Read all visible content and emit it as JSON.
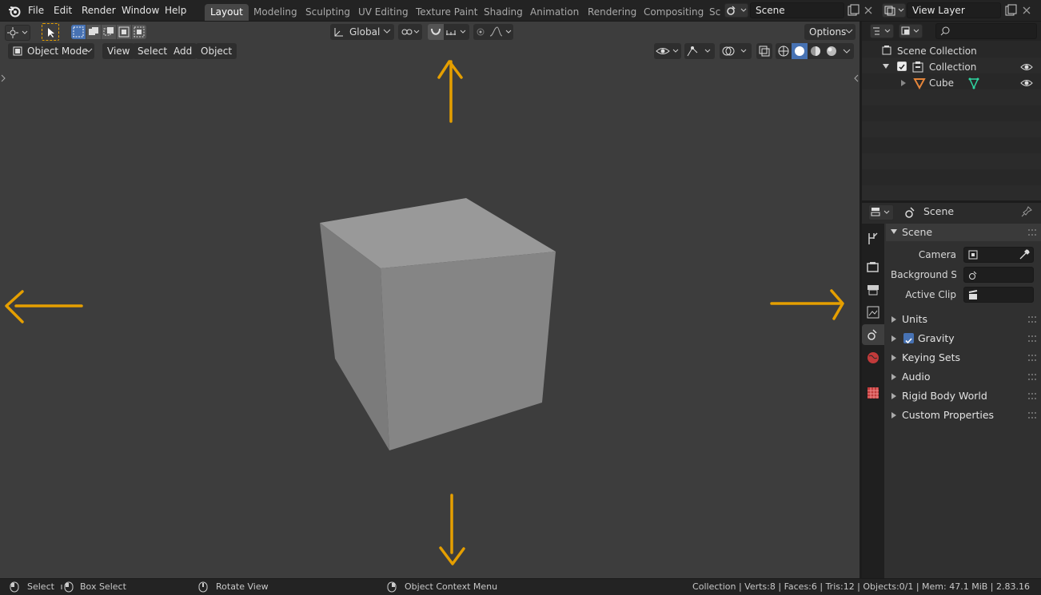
{
  "menu": {
    "items": [
      "File",
      "Edit",
      "Render",
      "Window",
      "Help"
    ]
  },
  "workspaces": {
    "tabs": [
      "Layout",
      "Modeling",
      "Sculpting",
      "UV Editing",
      "Texture Paint",
      "Shading",
      "Animation",
      "Rendering",
      "Compositing",
      "Sc"
    ],
    "active": "Layout"
  },
  "scene_selector": {
    "value": "Scene"
  },
  "viewlayer_selector": {
    "value": "View Layer"
  },
  "tool_header": {
    "orientation": "Global",
    "options_label": "Options"
  },
  "viewport_header": {
    "mode": "Object Mode",
    "menus": [
      "View",
      "Select",
      "Add",
      "Object"
    ]
  },
  "outliner": {
    "search_placeholder": "",
    "items": [
      {
        "label": "Scene Collection"
      },
      {
        "label": "Collection"
      },
      {
        "label": "Cube"
      }
    ]
  },
  "properties": {
    "context_label": "Scene",
    "panel_title": "Scene",
    "fields": [
      {
        "label": "Camera",
        "value": ""
      },
      {
        "label": "Background Sc...",
        "value": ""
      },
      {
        "label": "Active Clip",
        "value": ""
      }
    ],
    "subpanels": [
      "Units",
      "Gravity",
      "Keying Sets",
      "Audio",
      "Rigid Body World",
      "Custom Properties"
    ],
    "gravity_checked": true
  },
  "statusbar": {
    "select": "Select",
    "box_select": "Box Select",
    "rotate_view": "Rotate View",
    "context_menu": "Object Context Menu",
    "stats": "Collection | Verts:8 | Faces:6 | Tris:12 | Objects:0/1 | Mem: 47.1 MiB | 2.83.16"
  },
  "colors": {
    "accent": "#e59f00",
    "active_blue": "#4772b3",
    "bg": "#3d3d3d"
  }
}
